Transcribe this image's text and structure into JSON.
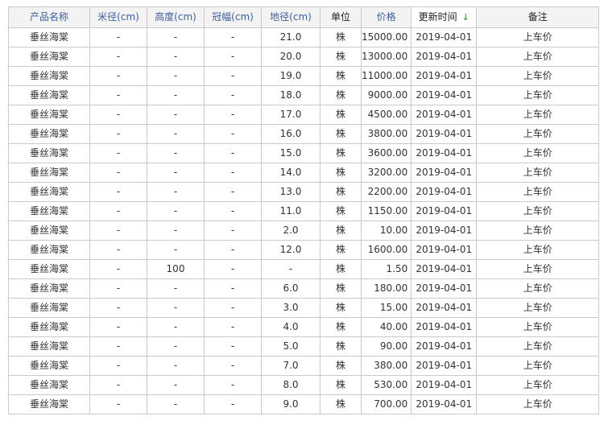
{
  "table": {
    "headers": [
      "产品名称",
      "米径(cm)",
      "高度(cm)",
      "冠幅(cm)",
      "地径(cm)",
      "单位",
      "价格",
      "更新时间",
      "备注"
    ],
    "sort_indicator": "↓",
    "rows": [
      [
        "垂丝海棠",
        "-",
        "-",
        "-",
        "21.0",
        "株",
        "15000.00",
        "2019-04-01",
        "上车价"
      ],
      [
        "垂丝海棠",
        "-",
        "-",
        "-",
        "20.0",
        "株",
        "13000.00",
        "2019-04-01",
        "上车价"
      ],
      [
        "垂丝海棠",
        "-",
        "-",
        "-",
        "19.0",
        "株",
        "11000.00",
        "2019-04-01",
        "上车价"
      ],
      [
        "垂丝海棠",
        "-",
        "-",
        "-",
        "18.0",
        "株",
        "9000.00",
        "2019-04-01",
        "上车价"
      ],
      [
        "垂丝海棠",
        "-",
        "-",
        "-",
        "17.0",
        "株",
        "4500.00",
        "2019-04-01",
        "上车价"
      ],
      [
        "垂丝海棠",
        "-",
        "-",
        "-",
        "16.0",
        "株",
        "3800.00",
        "2019-04-01",
        "上车价"
      ],
      [
        "垂丝海棠",
        "-",
        "-",
        "-",
        "15.0",
        "株",
        "3600.00",
        "2019-04-01",
        "上车价"
      ],
      [
        "垂丝海棠",
        "-",
        "-",
        "-",
        "14.0",
        "株",
        "3200.00",
        "2019-04-01",
        "上车价"
      ],
      [
        "垂丝海棠",
        "-",
        "-",
        "-",
        "13.0",
        "株",
        "2200.00",
        "2019-04-01",
        "上车价"
      ],
      [
        "垂丝海棠",
        "-",
        "-",
        "-",
        "11.0",
        "株",
        "1150.00",
        "2019-04-01",
        "上车价"
      ],
      [
        "垂丝海棠",
        "-",
        "-",
        "-",
        "2.0",
        "株",
        "10.00",
        "2019-04-01",
        "上车价"
      ],
      [
        "垂丝海棠",
        "-",
        "-",
        "-",
        "12.0",
        "株",
        "1600.00",
        "2019-04-01",
        "上车价"
      ],
      [
        "垂丝海棠",
        "-",
        "100",
        "-",
        "-",
        "株",
        "1.50",
        "2019-04-01",
        "上车价"
      ],
      [
        "垂丝海棠",
        "-",
        "-",
        "-",
        "6.0",
        "株",
        "180.00",
        "2019-04-01",
        "上车价"
      ],
      [
        "垂丝海棠",
        "-",
        "-",
        "-",
        "3.0",
        "株",
        "15.00",
        "2019-04-01",
        "上车价"
      ],
      [
        "垂丝海棠",
        "-",
        "-",
        "-",
        "4.0",
        "株",
        "40.00",
        "2019-04-01",
        "上车价"
      ],
      [
        "垂丝海棠",
        "-",
        "-",
        "-",
        "5.0",
        "株",
        "90.00",
        "2019-04-01",
        "上车价"
      ],
      [
        "垂丝海棠",
        "-",
        "-",
        "-",
        "7.0",
        "株",
        "380.00",
        "2019-04-01",
        "上车价"
      ],
      [
        "垂丝海棠",
        "-",
        "-",
        "-",
        "8.0",
        "株",
        "530.00",
        "2019-04-01",
        "上车价"
      ],
      [
        "垂丝海棠",
        "-",
        "-",
        "-",
        "9.0",
        "株",
        "700.00",
        "2019-04-01",
        "上车价"
      ]
    ]
  }
}
